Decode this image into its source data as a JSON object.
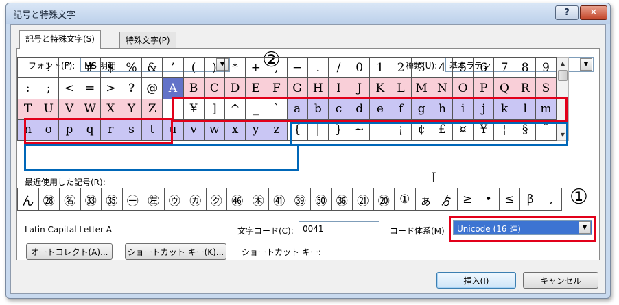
{
  "window": {
    "title": "記号と特殊文字",
    "help_glyph": "?",
    "close_glyph": "✕"
  },
  "tabs": [
    {
      "label": "記号と特殊文字(S)",
      "active": true
    },
    {
      "label": "特殊文字(P)",
      "active": false
    }
  ],
  "font": {
    "label": "フォント(F):",
    "value": "MS 明朝"
  },
  "subset": {
    "label": "種類(U):",
    "value": "基本ラテン"
  },
  "annotations": {
    "marker_1": "①",
    "marker_2": "②"
  },
  "grid": {
    "rows": [
      [
        "",
        "!",
        "″",
        "#",
        "$",
        "%",
        "&",
        "’",
        "(",
        ")",
        "*",
        "+",
        ",",
        "−",
        ".",
        "/",
        "0",
        "1",
        "2",
        "3",
        "4",
        "5",
        "6",
        "7",
        "8",
        "9"
      ],
      [
        ":",
        ";",
        "<",
        "=",
        ">",
        "?",
        "@",
        "A",
        "B",
        "C",
        "D",
        "E",
        "F",
        "G",
        "H",
        "I",
        "J",
        "K",
        "L",
        "M",
        "N",
        "O",
        "P",
        "Q",
        "R",
        "S"
      ],
      [
        "T",
        "U",
        "V",
        "W",
        "X",
        "Y",
        "Z",
        "[",
        "¥",
        "]",
        "^",
        "_",
        "`",
        "a",
        "b",
        "c",
        "d",
        "e",
        "f",
        "g",
        "h",
        "i",
        "j",
        "k",
        "l",
        "m"
      ],
      [
        "n",
        "o",
        "p",
        "q",
        "r",
        "s",
        "t",
        "u",
        "v",
        "w",
        "x",
        "y",
        "z",
        "{",
        "|",
        "}",
        "~",
        "",
        "¡",
        "¢",
        "£",
        "¤",
        "¥",
        "¦",
        "§",
        "¨"
      ]
    ],
    "selected": "A"
  },
  "recent": {
    "label": "最近使用した記号(R):",
    "symbols": [
      "ん",
      "㉘",
      "㊔",
      "㉝",
      "㉟",
      "㊀",
      "㊧",
      "㋒",
      "㋕",
      "㋗",
      "㊻",
      "㊍",
      "㊶",
      "㊴",
      "㊿",
      "㊱",
      "㉑",
      "⑳",
      "①",
      "ぁ",
      "ゟ",
      "≥",
      "•",
      "≤",
      "β",
      ","
    ]
  },
  "char_name": "Latin Capital Letter A",
  "char_code": {
    "label": "文字コード(C):",
    "value": "0041"
  },
  "code_system": {
    "label": "コード体系(M)",
    "value": "Unicode (16 進)"
  },
  "buttons": {
    "autocorrect": "オートコレクト(A)...",
    "shortcut_key": "ショートカット キー(K)...",
    "insert": "挿入(I)",
    "cancel": "キャンセル"
  },
  "shortcut_label": "ショートカット キー:",
  "colors": {
    "highlight_pink": "#f9cfd8",
    "highlight_lavender": "#c9c6f4",
    "selected_cell": "#6272c8",
    "annotation_red": "#e2001a",
    "annotation_blue": "#0067b8"
  }
}
